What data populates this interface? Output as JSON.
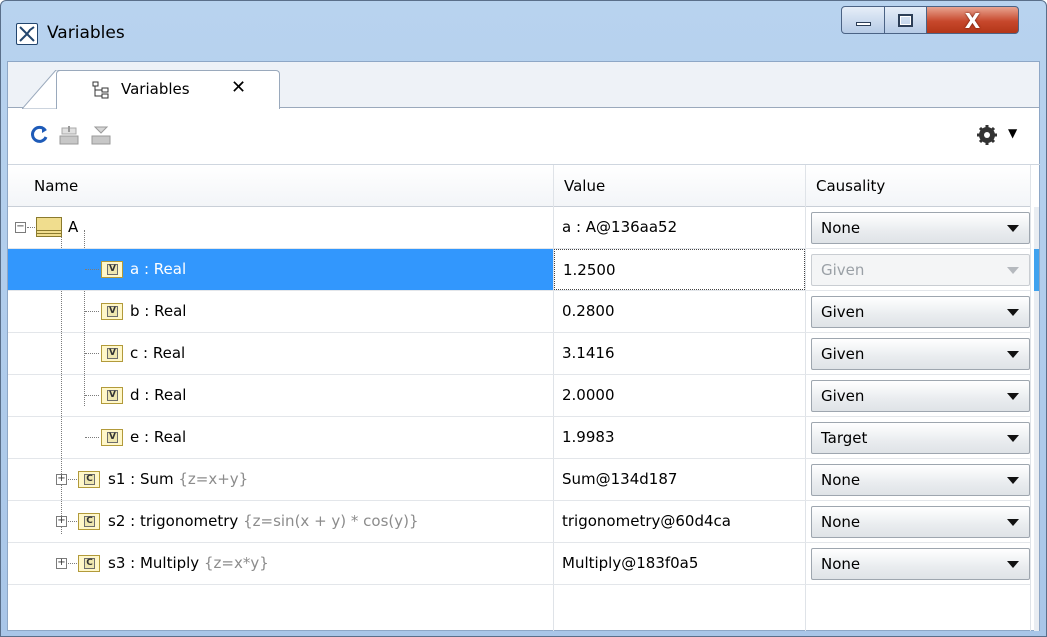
{
  "window": {
    "title": "Variables",
    "tab_label": "Variables",
    "tab_close": "✕",
    "close_glyph": "X"
  },
  "toolbar": {
    "icons": [
      "refresh-icon",
      "import-icon",
      "export-icon",
      "gear-icon"
    ],
    "gear_caret": "▼"
  },
  "table": {
    "columns": [
      "Name",
      "Value",
      "Causality"
    ],
    "rows": [
      {
        "name": "A",
        "expr": "",
        "value": "a : A@136aa52",
        "causality": "None"
      },
      {
        "name": "a : Real",
        "expr": "",
        "value": "1.2500",
        "causality": "Given"
      },
      {
        "name": "b : Real",
        "expr": "",
        "value": "0.2800",
        "causality": "Given"
      },
      {
        "name": "c : Real",
        "expr": "",
        "value": "3.1416",
        "causality": "Given"
      },
      {
        "name": "d : Real",
        "expr": "",
        "value": "2.0000",
        "causality": "Given"
      },
      {
        "name": "e : Real",
        "expr": "",
        "value": "1.9983",
        "causality": "Target"
      },
      {
        "name": "s1 : Sum ",
        "expr": "{z=x+y}",
        "value": "Sum@134d187",
        "causality": "None"
      },
      {
        "name": "s2 : trigonometry ",
        "expr": "{z=sin(x + y) * cos(y)}",
        "value": "trigonometry@60d4ca",
        "causality": "None"
      },
      {
        "name": "s3 : Multiply ",
        "expr": "{z=x*y}",
        "value": "Multiply@183f0a5",
        "causality": "None"
      }
    ]
  },
  "icon_letters": {
    "variable": "V",
    "component": "C"
  },
  "colors": {
    "selection": "#3297fd",
    "title_gradient": "#b8d3ef",
    "close_button": "#c7482c"
  }
}
